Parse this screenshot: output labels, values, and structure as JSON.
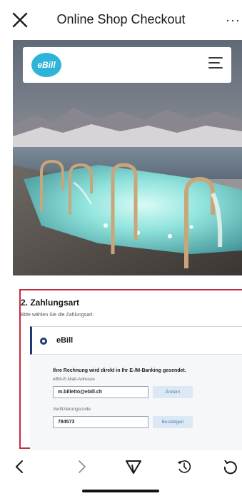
{
  "topbar": {
    "title": "Online Shop Checkout",
    "more_label": "···"
  },
  "site": {
    "logo_text": "eBill"
  },
  "payment": {
    "heading": "2. Zahlungsart",
    "subtitle": "Bitte wählen Sie die Zahlungsart.",
    "option_label": "eBill",
    "info_text": "Ihre Rechnung wird direkt in Ihr E-/M-Banking gesendet.",
    "email_label": "eBill-E-Mail-Adresse",
    "email_value": "m.billetto@ebill.ch",
    "change_button": "Ändern",
    "code_label": "Verifizierungscode",
    "code_value": "784573",
    "confirm_button": "Bestätigen"
  },
  "icons": {
    "close": "close-icon",
    "menu": "hamburger-menu-icon",
    "back": "chevron-left-icon",
    "forward": "chevron-right-icon",
    "share": "share-icon",
    "history": "history-icon",
    "reload": "reload-icon"
  },
  "colors": {
    "brand": "#2eb4d8",
    "highlight_border": "#c52b3a",
    "option_accent": "#1f3b73",
    "button_bg": "#dce9f5"
  }
}
